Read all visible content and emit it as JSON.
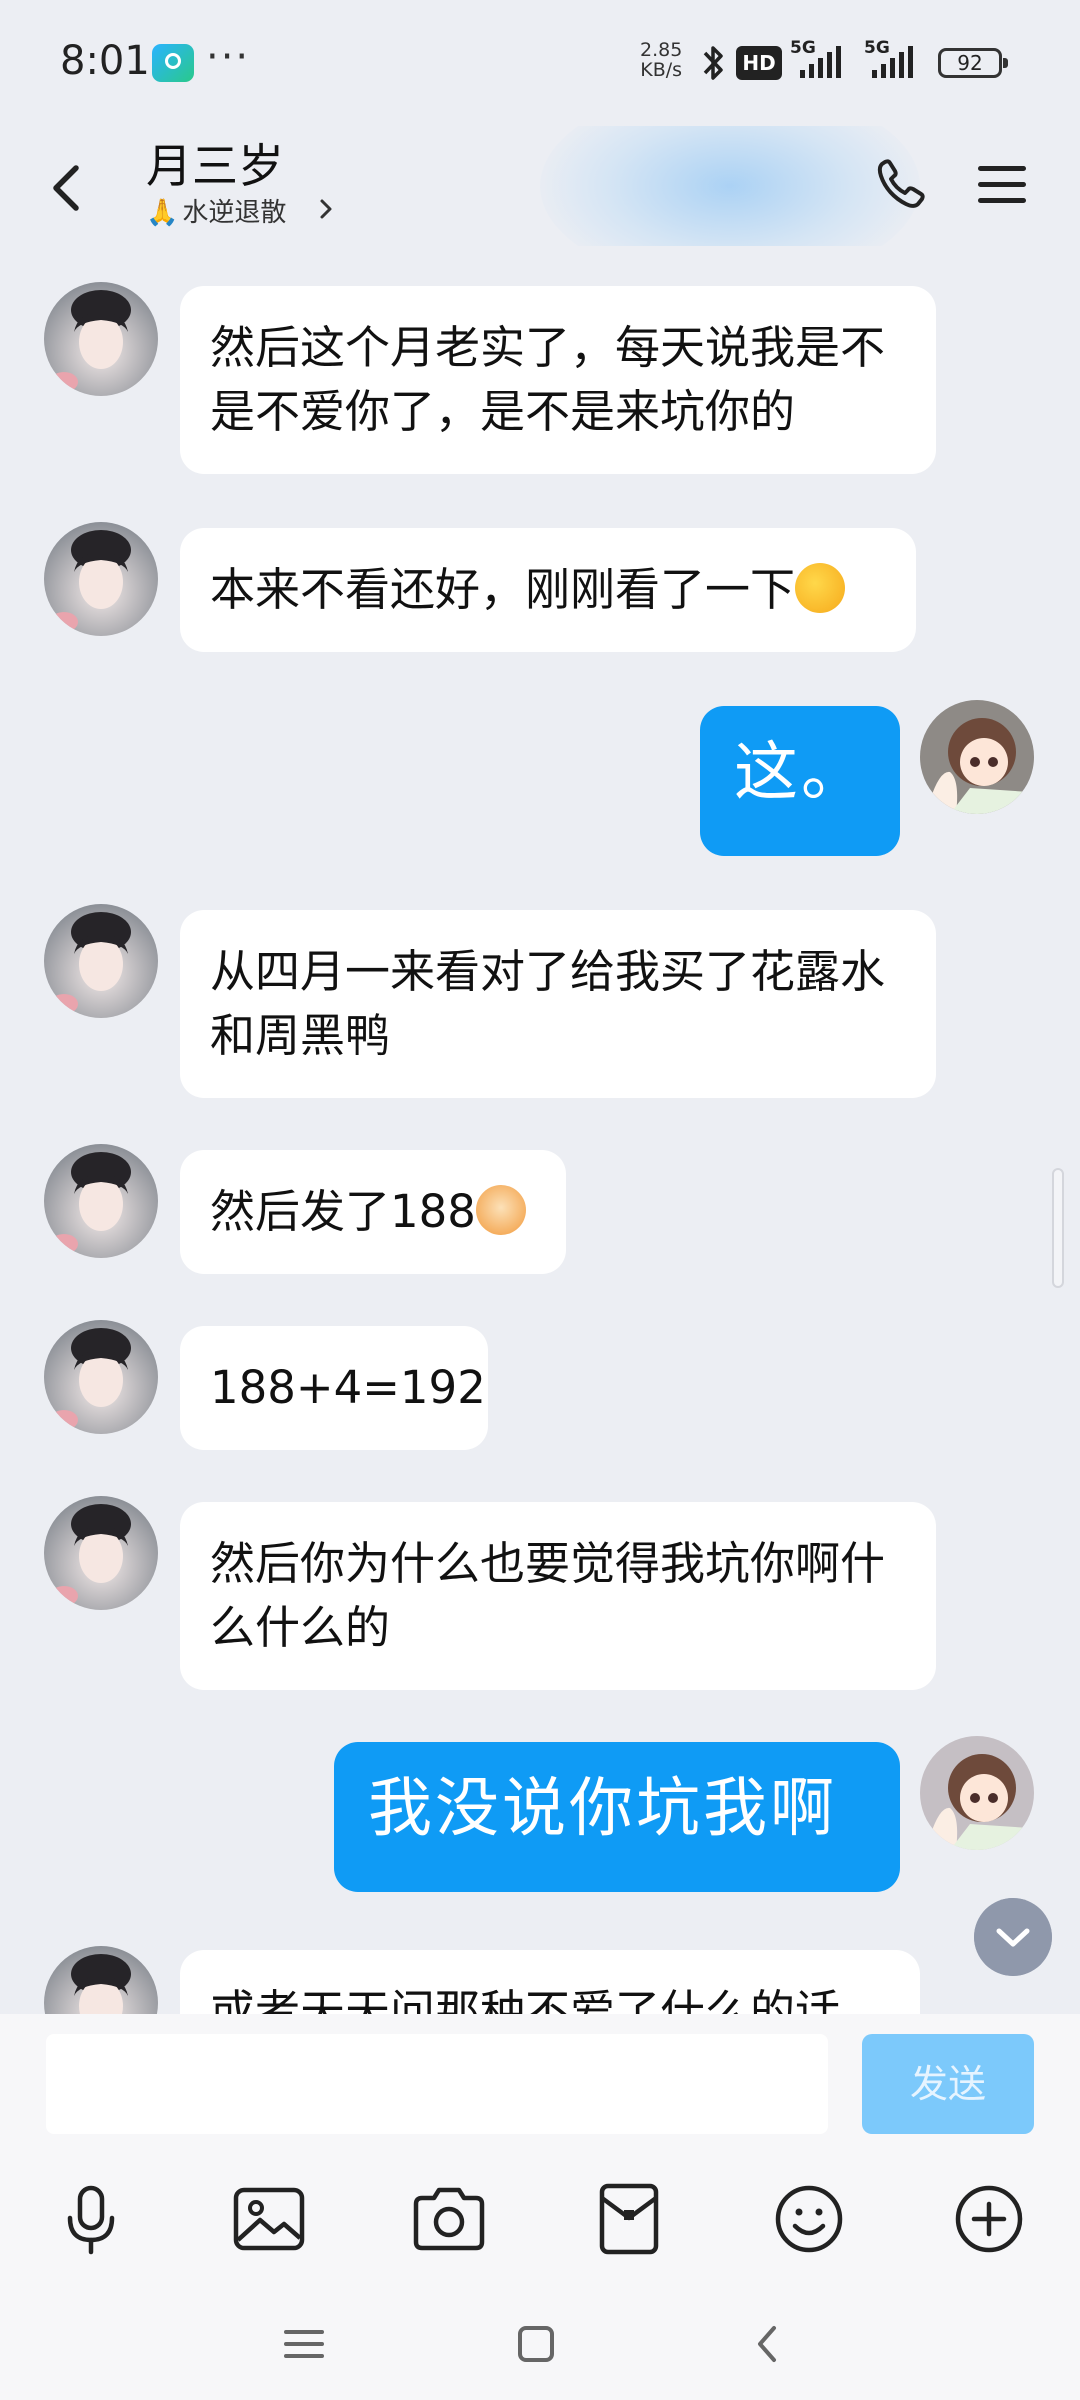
{
  "status_bar": {
    "time": "8:01",
    "more": "···",
    "speed_value": "2.85",
    "speed_unit": "KB/s",
    "hd_badge": "HD",
    "sim1": "5G",
    "sim2": "5G",
    "battery": "92"
  },
  "header": {
    "contact_name": "月三岁",
    "status_emoji": "🙏",
    "status_text": "水逆退散",
    "icons": [
      "back-icon",
      "phone-icon",
      "menu-icon",
      "chevron-right-icon"
    ]
  },
  "messages": [
    {
      "side": "in",
      "text": "然后这个月老实了，每天说我是不是不爱你了，是不是来坑你的"
    },
    {
      "side": "in",
      "text": "本来不看还好，刚刚看了一下",
      "emoji": "🤪"
    },
    {
      "side": "out",
      "text": "这。"
    },
    {
      "side": "in",
      "text": "从四月一来看对了给我买了花露水和周黑鸭"
    },
    {
      "side": "in",
      "text": "然后发了188",
      "emoji": "🐯"
    },
    {
      "side": "in",
      "text": "188+4=192"
    },
    {
      "side": "in",
      "text": "然后你为什么也要觉得我坑你啊什么什么的"
    },
    {
      "side": "out",
      "text": "我没说你坑我啊"
    },
    {
      "side": "in",
      "text": "或者天天问那种不爱了什么的话"
    }
  ],
  "composer": {
    "input_value": "",
    "send_label": "发送",
    "tools": [
      "microphone-icon",
      "image-icon",
      "camera-icon",
      "red-packet-icon",
      "emoji-icon",
      "plus-icon"
    ]
  },
  "nav": [
    "recent-apps-icon",
    "home-icon",
    "back-nav-icon"
  ],
  "colors": {
    "background": "#eceef3",
    "out_bubble": "#0f9bf5",
    "in_bubble": "#ffffff",
    "send_button": "#7cc9fb"
  }
}
